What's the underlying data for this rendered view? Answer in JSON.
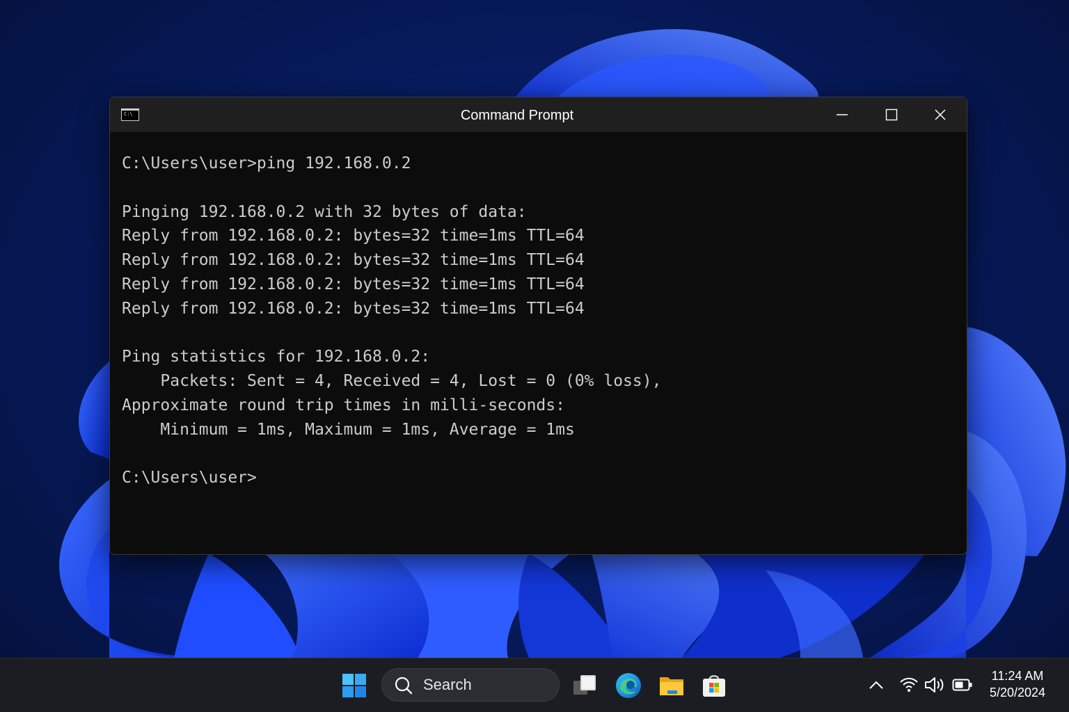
{
  "window": {
    "title": "Command Prompt",
    "icon_label": "C:\\",
    "controls": {
      "minimize_icon": "minimize-icon",
      "maximize_icon": "maximize-icon",
      "close_icon": "close-icon"
    }
  },
  "console": {
    "lines": [
      "C:\\Users\\user>ping 192.168.0.2",
      "",
      "Pinging 192.168.0.2 with 32 bytes of data:",
      "Reply from 192.168.0.2: bytes=32 time=1ms TTL=64",
      "Reply from 192.168.0.2: bytes=32 time=1ms TTL=64",
      "Reply from 192.168.0.2: bytes=32 time=1ms TTL=64",
      "Reply from 192.168.0.2: bytes=32 time=1ms TTL=64",
      "",
      "Ping statistics for 192.168.0.2:",
      "    Packets: Sent = 4, Received = 4, Lost = 0 (0% loss),",
      "Approximate round trip times in milli-seconds:",
      "    Minimum = 1ms, Maximum = 1ms, Average = 1ms",
      "",
      "C:\\Users\\user>"
    ]
  },
  "taskbar": {
    "search_label": "Search",
    "apps": [
      "windows-start-icon",
      "task-view-icon",
      "edge-icon",
      "file-explorer-icon",
      "store-icon"
    ],
    "tray": [
      "chevron-up-icon",
      "wifi-icon",
      "volume-icon",
      "battery-icon"
    ],
    "clock": {
      "time": "11:24 AM",
      "date": "5/20/2024"
    }
  },
  "colors": {
    "console_bg": "#0c0c0c",
    "console_text": "#cccccc",
    "titlebar_bg": "#1f1f1f",
    "taskbar_bg": "#1c1d22",
    "wallpaper_accent": "#1f4dff"
  }
}
